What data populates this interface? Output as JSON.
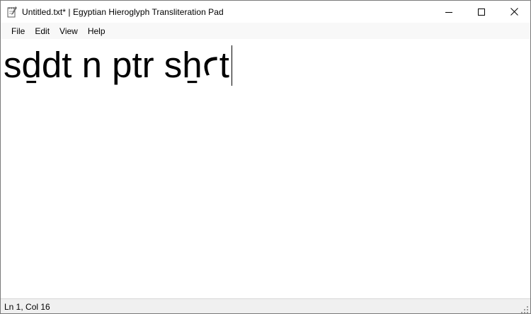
{
  "window": {
    "title": "Untitled.txt* | Egyptian Hieroglyph Transliteration Pad",
    "app_icon": "notepad-icon",
    "caption_buttons": [
      "minimize-icon",
      "maximize-icon",
      "close-icon"
    ]
  },
  "menu": {
    "items": [
      {
        "label": "File"
      },
      {
        "label": "Edit"
      },
      {
        "label": "View"
      },
      {
        "label": "Help"
      }
    ]
  },
  "editor": {
    "text": "sḏdt n ptr sẖꜥt"
  },
  "status": {
    "position": "Ln 1, Col 16"
  }
}
